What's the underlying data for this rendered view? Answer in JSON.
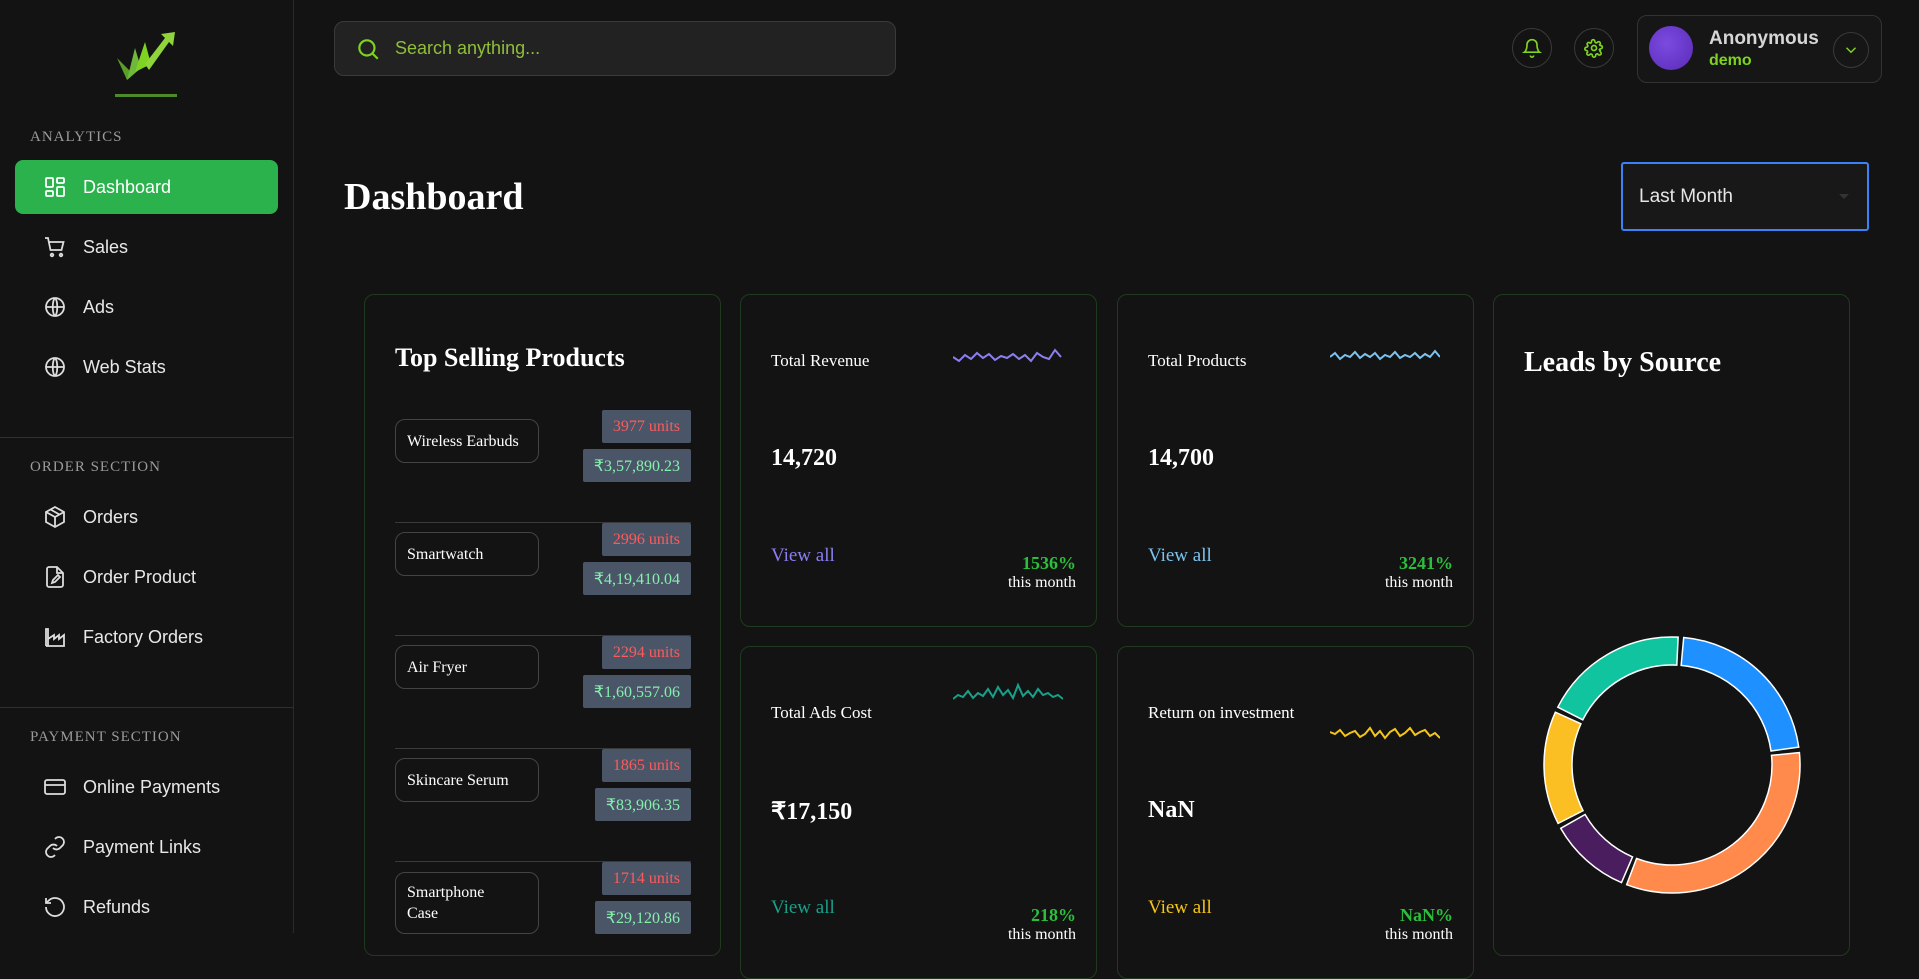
{
  "search": {
    "placeholder": "Search anything..."
  },
  "user": {
    "name": "Anonymous",
    "role": "demo"
  },
  "sidebar": {
    "sections": [
      {
        "title": "ANALYTICS",
        "items": [
          {
            "label": "Dashboard",
            "icon": "dashboard-icon",
            "active": true
          },
          {
            "label": "Sales",
            "icon": "cart-icon"
          },
          {
            "label": "Ads",
            "icon": "globe-icon"
          },
          {
            "label": "Web Stats",
            "icon": "globe-icon"
          }
        ]
      },
      {
        "title": "ORDER SECTION",
        "items": [
          {
            "label": "Orders",
            "icon": "package-icon"
          },
          {
            "label": "Order Product",
            "icon": "file-edit-icon"
          },
          {
            "label": "Factory Orders",
            "icon": "factory-icon"
          }
        ]
      },
      {
        "title": "PAYMENT SECTION",
        "items": [
          {
            "label": "Online Payments",
            "icon": "credit-card-icon"
          },
          {
            "label": "Payment Links",
            "icon": "link-icon"
          },
          {
            "label": "Refunds",
            "icon": "refund-icon"
          }
        ]
      }
    ]
  },
  "page": {
    "title": "Dashboard",
    "period": "Last Month"
  },
  "top_selling": {
    "title": "Top Selling Products",
    "products": [
      {
        "name": "Wireless Earbuds",
        "units": "3977 units",
        "revenue": "₹3,57,890.23"
      },
      {
        "name": "Smartwatch",
        "units": "2996 units",
        "revenue": "₹4,19,410.04"
      },
      {
        "name": "Air Fryer",
        "units": "2294 units",
        "revenue": "₹1,60,557.06"
      },
      {
        "name": "Skincare Serum",
        "units": "1865 units",
        "revenue": "₹83,906.35"
      },
      {
        "name": "Smartphone Case",
        "units": "1714 units",
        "revenue": "₹29,120.86"
      }
    ]
  },
  "stats": [
    {
      "label": "Total Revenue",
      "value": "14,720",
      "link": "View all",
      "pct": "1536%",
      "sub": "this month",
      "color": "#8a7ff0"
    },
    {
      "label": "Total Products",
      "value": "14,700",
      "link": "View all",
      "pct": "3241%",
      "sub": "this month",
      "color": "#7cc4f0"
    },
    {
      "label": "Total Ads Cost",
      "value": "₹17,150",
      "link": "View all",
      "pct": "218%",
      "sub": "this month",
      "color": "#17a08a"
    },
    {
      "label": "Return on investment",
      "value": "NaN",
      "link": "View all",
      "pct": "NaN%",
      "sub": "this month",
      "color": "#f5c518"
    }
  ],
  "leads": {
    "title": "Leads by Source",
    "chart_data": {
      "type": "pie",
      "variant": "donut",
      "slices": [
        {
          "value": 22,
          "color": "#1e90ff"
        },
        {
          "value": 33,
          "color": "#ff8a4c"
        },
        {
          "value": 11,
          "color": "#4a1e5e"
        },
        {
          "value": 15,
          "color": "#fbbf24"
        },
        {
          "value": 19,
          "color": "#10c4a0"
        }
      ]
    }
  }
}
